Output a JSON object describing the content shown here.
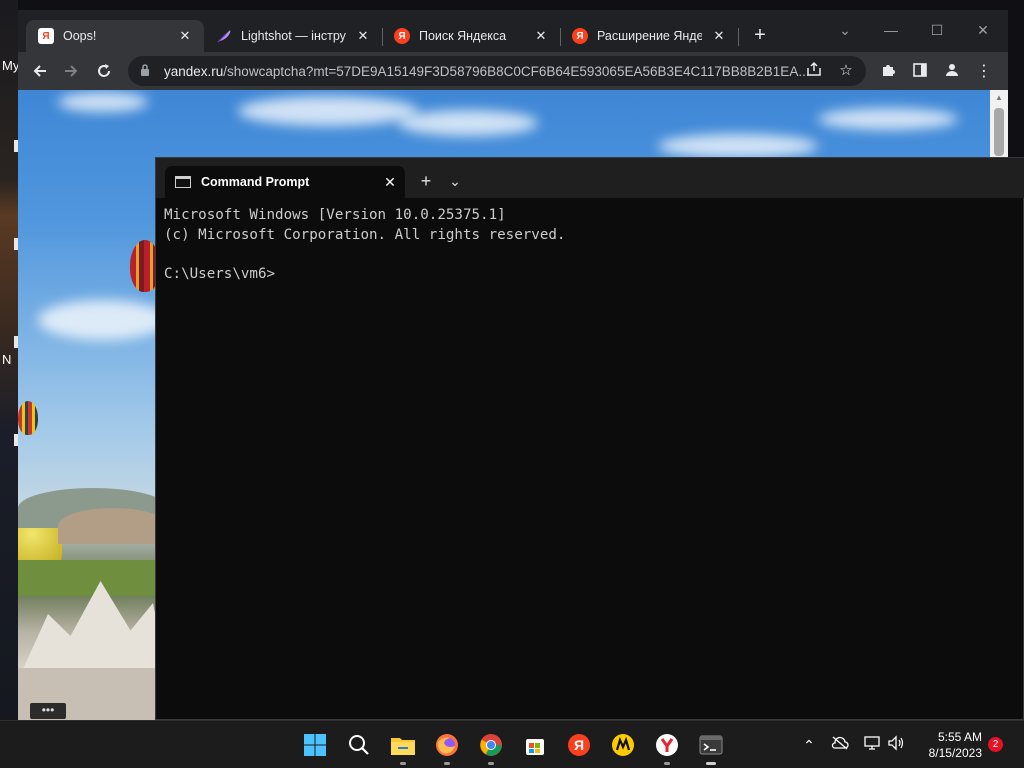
{
  "desktop": {
    "labels": [
      "My",
      "N"
    ]
  },
  "browser": {
    "tabs": [
      {
        "title": "Oops!",
        "favicon": "yandex-white-icon",
        "active": true
      },
      {
        "title": "Lightshot — інструмс",
        "favicon": "feather-icon",
        "active": false
      },
      {
        "title": "Поиск Яндекса",
        "favicon": "yandex-icon",
        "active": false
      },
      {
        "title": "Расширение Яндекса",
        "favicon": "yandex-icon",
        "active": false
      }
    ],
    "tab_close_glyph": "✕",
    "new_tab_glyph": "+",
    "address_host": "yandex.ru",
    "address_path": "/showcaptcha?mt=57DE9A15149F3D58796B8C0CF6B64E593065EA56B3E4C117BB8B2B1EA...",
    "more_button_label": "•••"
  },
  "terminal": {
    "tab_title": "Command Prompt",
    "close_glyph": "✕",
    "new_tab_glyph": "+",
    "dropdown_glyph": "⌄",
    "lines": [
      "Microsoft Windows [Version 10.0.25375.1]",
      "(c) Microsoft Corporation. All rights reserved.",
      "",
      "C:\\Users\\vm6>"
    ]
  },
  "taskbar": {
    "apps": [
      "start-icon",
      "search-icon",
      "file-explorer-icon",
      "firefox-icon",
      "chrome-icon",
      "store-icon",
      "yandex-icon",
      "yandex-market-icon",
      "yandex-browser-icon",
      "terminal-icon"
    ],
    "time": "5:55 AM",
    "date": "8/15/2023",
    "notification_count": "2"
  },
  "colors": {
    "browser_bg": "#202124",
    "toolbar_bg": "#35363a",
    "terminal_bg": "#0c0c0c",
    "taskbar_bg": "#1c1c1c",
    "yandex_red": "#fc3f1d"
  }
}
